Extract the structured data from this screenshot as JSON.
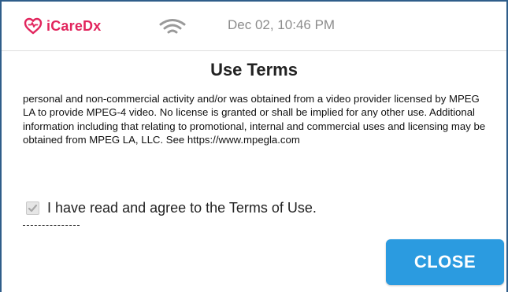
{
  "header": {
    "brand": "iCareDx",
    "brand_color": "#e2255d",
    "logo_icon": "heart-pulse-icon",
    "status_icon": "wifi-icon",
    "datetime": "Dec 02, 10:46 PM"
  },
  "dialog": {
    "title": "Use Terms",
    "body": "personal and non-commercial activity and/or was obtained from a video provider licensed by MPEG LA to provide MPEG-4 video. No license is granted or shall be implied for any other use. Additional information including that relating to promotional, internal and commercial uses and licensing may be obtained from MPEG LA, LLC. See https://www.mpegla.com",
    "agree_checkbox": {
      "label": "I have read and agree to the Terms of Use.",
      "checked": true
    },
    "separator_text": "----------------",
    "close_label": "CLOSE",
    "close_color": "#2b9be0"
  }
}
